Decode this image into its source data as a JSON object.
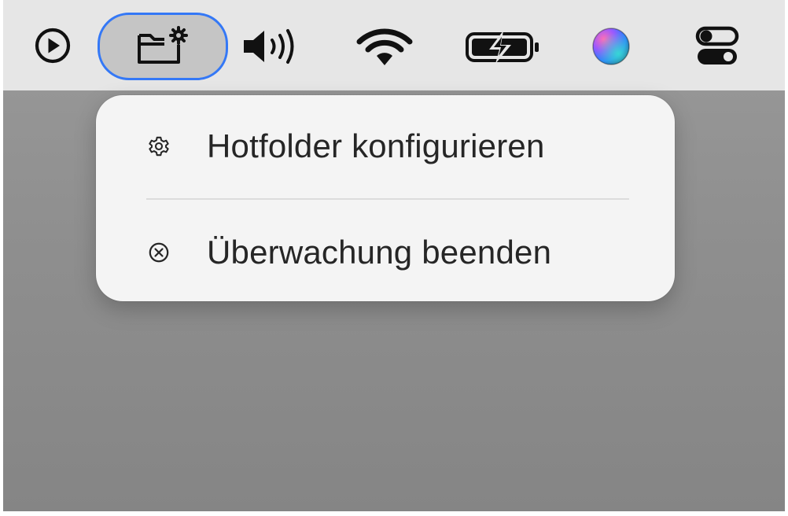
{
  "menubar": {
    "items": [
      {
        "icon": "play-circle-icon"
      },
      {
        "icon": "folder-gear-icon",
        "active": true
      },
      {
        "icon": "speaker-volume-icon"
      },
      {
        "icon": "wifi-icon"
      },
      {
        "icon": "battery-charging-icon"
      },
      {
        "icon": "siri-icon"
      },
      {
        "icon": "control-center-icon"
      }
    ]
  },
  "menu": {
    "items": [
      {
        "label": "Hotfolder konfigurieren",
        "icon": "gear-icon"
      },
      {
        "label": "Überwachung beenden",
        "icon": "x-circle-icon"
      }
    ]
  },
  "colors": {
    "menubar_bg": "#e6e6e6",
    "desktop_bg": "#8f8f8f",
    "menu_bg": "#f4f4f4",
    "focus_ring": "#3478f6",
    "active_item_bg": "#c5c5c5",
    "text": "#262626"
  }
}
